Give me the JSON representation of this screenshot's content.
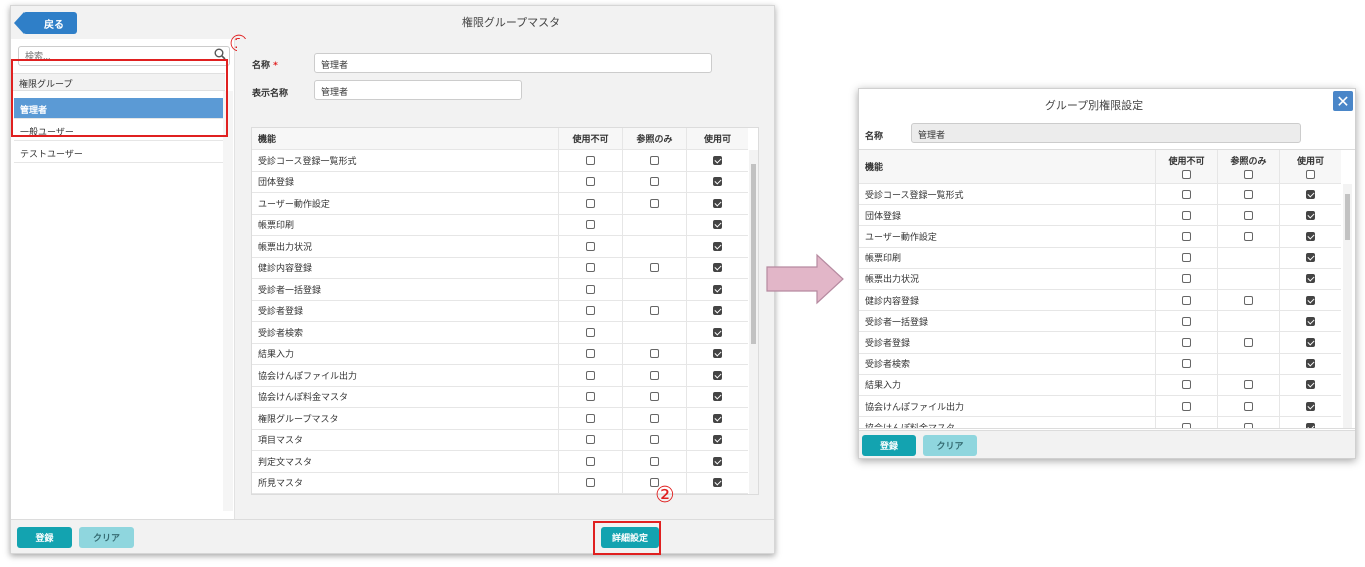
{
  "main": {
    "title": "権限グループマスタ",
    "back_label": "戻る",
    "search_placeholder": "検索...",
    "group_header": "権限グループ",
    "groups": [
      {
        "label": "管理者",
        "selected": true
      },
      {
        "label": "一般ユーザー",
        "selected": false
      },
      {
        "label": "テストユーザー",
        "selected": false
      }
    ],
    "form": {
      "name_label": "名称",
      "required_mark": "*",
      "name_value": "管理者",
      "display_label": "表示名称",
      "display_value": "管理者"
    },
    "table": {
      "headers": [
        "機能",
        "使用不可",
        "参照のみ",
        "使用可"
      ],
      "rows": [
        {
          "name": "受診コース登録一覧形式",
          "cols": [
            0,
            0,
            1
          ]
        },
        {
          "name": "団体登録",
          "cols": [
            0,
            0,
            1
          ]
        },
        {
          "name": "ユーザー動作設定",
          "cols": [
            0,
            0,
            1
          ]
        },
        {
          "name": "帳票印刷",
          "cols": [
            0,
            null,
            1
          ]
        },
        {
          "name": "帳票出力状況",
          "cols": [
            0,
            null,
            1
          ]
        },
        {
          "name": "健診内容登録",
          "cols": [
            0,
            0,
            1
          ]
        },
        {
          "name": "受診者一括登録",
          "cols": [
            0,
            null,
            1
          ]
        },
        {
          "name": "受診者登録",
          "cols": [
            0,
            0,
            1
          ]
        },
        {
          "name": "受診者検索",
          "cols": [
            0,
            null,
            1
          ]
        },
        {
          "name": "結果入力",
          "cols": [
            0,
            0,
            1
          ]
        },
        {
          "name": "協会けんぽファイル出力",
          "cols": [
            0,
            0,
            1
          ]
        },
        {
          "name": "協会けんぽ料金マスタ",
          "cols": [
            0,
            0,
            1
          ]
        },
        {
          "name": "権限グループマスタ",
          "cols": [
            0,
            0,
            1
          ]
        },
        {
          "name": "項目マスタ",
          "cols": [
            0,
            0,
            1
          ]
        },
        {
          "name": "判定文マスタ",
          "cols": [
            0,
            0,
            1
          ]
        },
        {
          "name": "所見マスタ",
          "cols": [
            0,
            0,
            1
          ]
        }
      ]
    },
    "register_label": "登録",
    "clear_label": "クリア",
    "detail_label": "詳細設定",
    "marker_1": "①",
    "marker_2": "②"
  },
  "dialog": {
    "title": "グループ別権限設定",
    "close_icon": "close-icon",
    "name_label": "名称",
    "name_value": "管理者",
    "headers": [
      "機能",
      "使用不可",
      "参照のみ",
      "使用可"
    ],
    "rows": [
      {
        "name": "受診コース登録一覧形式",
        "cols": [
          0,
          0,
          1
        ]
      },
      {
        "name": "団体登録",
        "cols": [
          0,
          0,
          1
        ]
      },
      {
        "name": "ユーザー動作設定",
        "cols": [
          0,
          0,
          1
        ]
      },
      {
        "name": "帳票印刷",
        "cols": [
          0,
          null,
          1
        ]
      },
      {
        "name": "帳票出力状況",
        "cols": [
          0,
          null,
          1
        ]
      },
      {
        "name": "健診内容登録",
        "cols": [
          0,
          0,
          1
        ]
      },
      {
        "name": "受診者一括登録",
        "cols": [
          0,
          null,
          1
        ]
      },
      {
        "name": "受診者登録",
        "cols": [
          0,
          0,
          1
        ]
      },
      {
        "name": "受診者検索",
        "cols": [
          0,
          null,
          1
        ]
      },
      {
        "name": "結果入力",
        "cols": [
          0,
          0,
          1
        ]
      },
      {
        "name": "協会けんぽファイル出力",
        "cols": [
          0,
          0,
          1
        ]
      },
      {
        "name": "協会けんぽ料金マスタ",
        "cols": [
          0,
          0,
          1
        ]
      }
    ],
    "register_label": "登録",
    "clear_label": "クリア"
  },
  "colors": {
    "accent_teal": "#13a3b0",
    "selected_blue": "#5b9ad5",
    "back_blue": "#2f7fc8",
    "highlight_red": "#e02020",
    "arrow_pink": "#e2b6c8"
  }
}
